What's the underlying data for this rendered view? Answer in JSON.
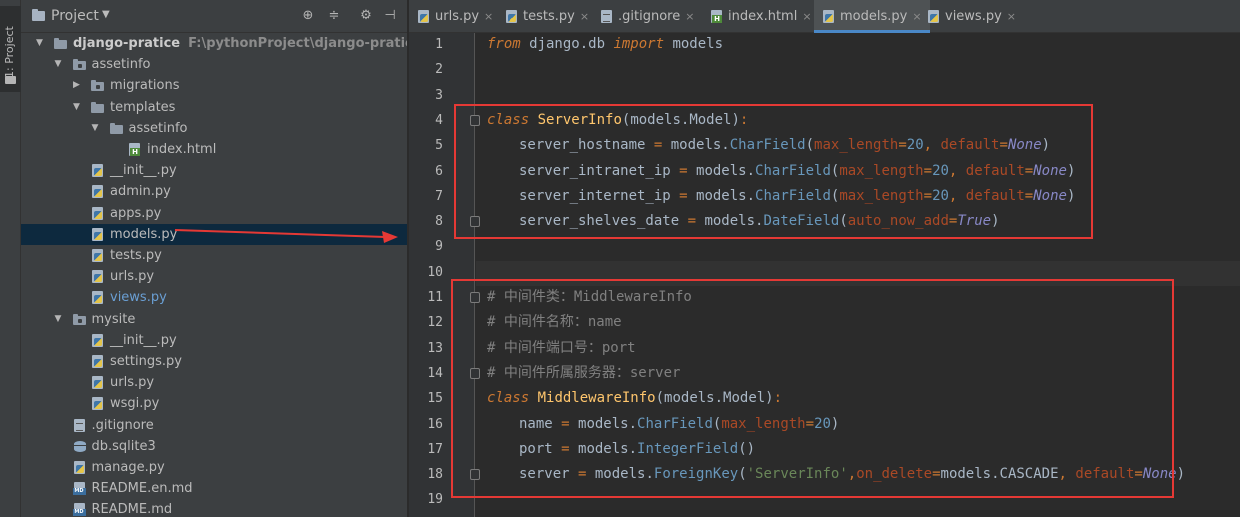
{
  "toolstrip": {
    "project_tab": "1: Project"
  },
  "project_panel": {
    "title": "Project",
    "tree": [
      {
        "label": "django-pratice",
        "path": "F:\\pythonProject\\django-pratice",
        "depth": 0,
        "type": "folder",
        "expanded": true,
        "bold": true
      },
      {
        "label": "assetinfo",
        "depth": 1,
        "type": "pkg",
        "expanded": true
      },
      {
        "label": "migrations",
        "depth": 2,
        "type": "pkg",
        "expanded": false
      },
      {
        "label": "templates",
        "depth": 2,
        "type": "folder",
        "expanded": true
      },
      {
        "label": "assetinfo",
        "depth": 3,
        "type": "folder",
        "expanded": true
      },
      {
        "label": "index.html",
        "depth": 4,
        "type": "html"
      },
      {
        "label": "__init__.py",
        "depth": 2,
        "type": "py"
      },
      {
        "label": "admin.py",
        "depth": 2,
        "type": "py"
      },
      {
        "label": "apps.py",
        "depth": 2,
        "type": "py"
      },
      {
        "label": "models.py",
        "depth": 2,
        "type": "py",
        "selected": true
      },
      {
        "label": "tests.py",
        "depth": 2,
        "type": "py"
      },
      {
        "label": "urls.py",
        "depth": 2,
        "type": "py"
      },
      {
        "label": "views.py",
        "depth": 2,
        "type": "py",
        "modified": true
      },
      {
        "label": "mysite",
        "depth": 1,
        "type": "pkg",
        "expanded": true
      },
      {
        "label": "__init__.py",
        "depth": 2,
        "type": "py"
      },
      {
        "label": "settings.py",
        "depth": 2,
        "type": "py"
      },
      {
        "label": "urls.py",
        "depth": 2,
        "type": "py"
      },
      {
        "label": "wsgi.py",
        "depth": 2,
        "type": "py"
      },
      {
        "label": ".gitignore",
        "depth": 1,
        "type": "txt"
      },
      {
        "label": "db.sqlite3",
        "depth": 1,
        "type": "db"
      },
      {
        "label": "manage.py",
        "depth": 1,
        "type": "py"
      },
      {
        "label": "README.en.md",
        "depth": 1,
        "type": "md"
      },
      {
        "label": "README.md",
        "depth": 1,
        "type": "md"
      }
    ]
  },
  "tabs": [
    {
      "label": "urls.py",
      "type": "py",
      "active": false
    },
    {
      "label": "tests.py",
      "type": "py",
      "active": false
    },
    {
      "label": ".gitignore",
      "type": "txt",
      "active": false
    },
    {
      "label": "index.html",
      "type": "html",
      "active": false
    },
    {
      "label": "models.py",
      "type": "py",
      "active": true
    },
    {
      "label": "views.py",
      "type": "py",
      "active": false
    }
  ],
  "editor": {
    "current_line": 10,
    "lines": [
      {
        "n": 1,
        "indent": 0,
        "tokens": [
          [
            "kw",
            "from"
          ],
          [
            "ident",
            " django.db "
          ],
          [
            "kw",
            "import"
          ],
          [
            "ident",
            " models"
          ]
        ]
      },
      {
        "n": 2,
        "indent": 0,
        "tokens": []
      },
      {
        "n": 3,
        "indent": 0,
        "tokens": []
      },
      {
        "n": 4,
        "indent": 0,
        "tokens": [
          [
            "kw",
            "class"
          ],
          [
            "ident",
            " "
          ],
          [
            "cls",
            "ServerInfo"
          ],
          [
            "ident",
            "(models.Model)"
          ],
          [
            "op",
            ":"
          ]
        ]
      },
      {
        "n": 5,
        "indent": 1,
        "tokens": [
          [
            "ident",
            "server_hostname "
          ],
          [
            "op",
            "="
          ],
          [
            "ident",
            " models."
          ],
          [
            "fn",
            "CharField"
          ],
          [
            "ident",
            "("
          ],
          [
            "param",
            "max_length"
          ],
          [
            "op",
            "="
          ],
          [
            "num",
            "20"
          ],
          [
            "op",
            ", "
          ],
          [
            "param",
            "default"
          ],
          [
            "op",
            "="
          ],
          [
            "none",
            "None"
          ],
          [
            "ident",
            ")"
          ]
        ]
      },
      {
        "n": 6,
        "indent": 1,
        "tokens": [
          [
            "ident",
            "server_intranet_ip "
          ],
          [
            "op",
            "="
          ],
          [
            "ident",
            " models."
          ],
          [
            "fn",
            "CharField"
          ],
          [
            "ident",
            "("
          ],
          [
            "param",
            "max_length"
          ],
          [
            "op",
            "="
          ],
          [
            "num",
            "20"
          ],
          [
            "op",
            ", "
          ],
          [
            "param",
            "default"
          ],
          [
            "op",
            "="
          ],
          [
            "none",
            "None"
          ],
          [
            "ident",
            ")"
          ]
        ]
      },
      {
        "n": 7,
        "indent": 1,
        "tokens": [
          [
            "ident",
            "server_internet_ip "
          ],
          [
            "op",
            "="
          ],
          [
            "ident",
            " models."
          ],
          [
            "fn",
            "CharField"
          ],
          [
            "ident",
            "("
          ],
          [
            "param",
            "max_length"
          ],
          [
            "op",
            "="
          ],
          [
            "num",
            "20"
          ],
          [
            "op",
            ", "
          ],
          [
            "param",
            "default"
          ],
          [
            "op",
            "="
          ],
          [
            "none",
            "None"
          ],
          [
            "ident",
            ")"
          ]
        ]
      },
      {
        "n": 8,
        "indent": 1,
        "tokens": [
          [
            "ident",
            "server_shelves_date "
          ],
          [
            "op",
            "="
          ],
          [
            "ident",
            " models."
          ],
          [
            "fn",
            "DateField"
          ],
          [
            "ident",
            "("
          ],
          [
            "param",
            "auto_now_add"
          ],
          [
            "op",
            "="
          ],
          [
            "none",
            "True"
          ],
          [
            "ident",
            ")"
          ]
        ]
      },
      {
        "n": 9,
        "indent": 0,
        "tokens": []
      },
      {
        "n": 10,
        "indent": 0,
        "tokens": []
      },
      {
        "n": 11,
        "indent": 0,
        "tokens": [
          [
            "cmt",
            "# 中间件类：MiddlewareInfo"
          ]
        ]
      },
      {
        "n": 12,
        "indent": 0,
        "tokens": [
          [
            "cmt",
            "# 中间件名称：name"
          ]
        ]
      },
      {
        "n": 13,
        "indent": 0,
        "tokens": [
          [
            "cmt",
            "# 中间件端口号：port"
          ]
        ]
      },
      {
        "n": 14,
        "indent": 0,
        "tokens": [
          [
            "cmt",
            "# 中间件所属服务器：server"
          ]
        ]
      },
      {
        "n": 15,
        "indent": 0,
        "tokens": [
          [
            "kw",
            "class"
          ],
          [
            "ident",
            " "
          ],
          [
            "cls",
            "MiddlewareInfo"
          ],
          [
            "ident",
            "(models.Model)"
          ],
          [
            "op",
            ":"
          ]
        ]
      },
      {
        "n": 16,
        "indent": 1,
        "tokens": [
          [
            "ident",
            "name "
          ],
          [
            "op",
            "="
          ],
          [
            "ident",
            " models."
          ],
          [
            "fn",
            "CharField"
          ],
          [
            "ident",
            "("
          ],
          [
            "param",
            "max_length"
          ],
          [
            "op",
            "="
          ],
          [
            "num",
            "20"
          ],
          [
            "ident",
            ")"
          ]
        ]
      },
      {
        "n": 17,
        "indent": 1,
        "tokens": [
          [
            "ident",
            "port "
          ],
          [
            "op",
            "="
          ],
          [
            "ident",
            " models."
          ],
          [
            "fn",
            "IntegerField"
          ],
          [
            "ident",
            "()"
          ]
        ]
      },
      {
        "n": 18,
        "indent": 1,
        "tokens": [
          [
            "ident",
            "server "
          ],
          [
            "op",
            "="
          ],
          [
            "ident",
            " models."
          ],
          [
            "fn",
            "ForeignKey"
          ],
          [
            "ident",
            "("
          ],
          [
            "str",
            "'ServerInfo'"
          ],
          [
            "op",
            ","
          ],
          [
            "param",
            "on_delete"
          ],
          [
            "op",
            "="
          ],
          [
            "ident",
            "models.CASCADE"
          ],
          [
            "op",
            ", "
          ],
          [
            "param",
            "default"
          ],
          [
            "op",
            "="
          ],
          [
            "none",
            "None"
          ],
          [
            "ident",
            ")"
          ]
        ]
      },
      {
        "n": 19,
        "indent": 0,
        "tokens": []
      }
    ]
  },
  "colors": {
    "annotation": "#e53935",
    "selection": "#0d293e",
    "accent": "#4a88c7"
  }
}
